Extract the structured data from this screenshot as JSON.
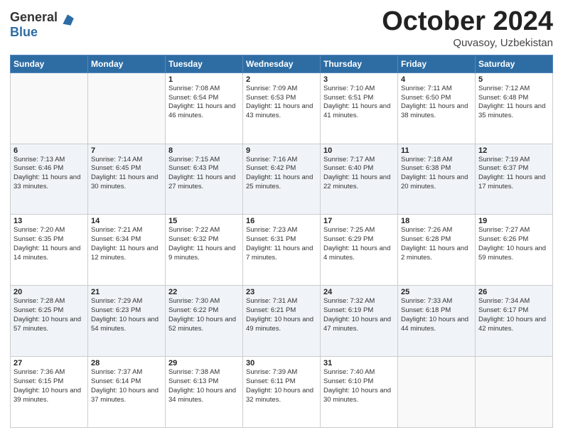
{
  "logo": {
    "general": "General",
    "blue": "Blue"
  },
  "header": {
    "month": "October 2024",
    "location": "Quvasoy, Uzbekistan"
  },
  "weekdays": [
    "Sunday",
    "Monday",
    "Tuesday",
    "Wednesday",
    "Thursday",
    "Friday",
    "Saturday"
  ],
  "weeks": [
    [
      {
        "day": null
      },
      {
        "day": null
      },
      {
        "day": "1",
        "sunrise": "Sunrise: 7:08 AM",
        "sunset": "Sunset: 6:54 PM",
        "daylight": "Daylight: 11 hours and 46 minutes."
      },
      {
        "day": "2",
        "sunrise": "Sunrise: 7:09 AM",
        "sunset": "Sunset: 6:53 PM",
        "daylight": "Daylight: 11 hours and 43 minutes."
      },
      {
        "day": "3",
        "sunrise": "Sunrise: 7:10 AM",
        "sunset": "Sunset: 6:51 PM",
        "daylight": "Daylight: 11 hours and 41 minutes."
      },
      {
        "day": "4",
        "sunrise": "Sunrise: 7:11 AM",
        "sunset": "Sunset: 6:50 PM",
        "daylight": "Daylight: 11 hours and 38 minutes."
      },
      {
        "day": "5",
        "sunrise": "Sunrise: 7:12 AM",
        "sunset": "Sunset: 6:48 PM",
        "daylight": "Daylight: 11 hours and 35 minutes."
      }
    ],
    [
      {
        "day": "6",
        "sunrise": "Sunrise: 7:13 AM",
        "sunset": "Sunset: 6:46 PM",
        "daylight": "Daylight: 11 hours and 33 minutes."
      },
      {
        "day": "7",
        "sunrise": "Sunrise: 7:14 AM",
        "sunset": "Sunset: 6:45 PM",
        "daylight": "Daylight: 11 hours and 30 minutes."
      },
      {
        "day": "8",
        "sunrise": "Sunrise: 7:15 AM",
        "sunset": "Sunset: 6:43 PM",
        "daylight": "Daylight: 11 hours and 27 minutes."
      },
      {
        "day": "9",
        "sunrise": "Sunrise: 7:16 AM",
        "sunset": "Sunset: 6:42 PM",
        "daylight": "Daylight: 11 hours and 25 minutes."
      },
      {
        "day": "10",
        "sunrise": "Sunrise: 7:17 AM",
        "sunset": "Sunset: 6:40 PM",
        "daylight": "Daylight: 11 hours and 22 minutes."
      },
      {
        "day": "11",
        "sunrise": "Sunrise: 7:18 AM",
        "sunset": "Sunset: 6:38 PM",
        "daylight": "Daylight: 11 hours and 20 minutes."
      },
      {
        "day": "12",
        "sunrise": "Sunrise: 7:19 AM",
        "sunset": "Sunset: 6:37 PM",
        "daylight": "Daylight: 11 hours and 17 minutes."
      }
    ],
    [
      {
        "day": "13",
        "sunrise": "Sunrise: 7:20 AM",
        "sunset": "Sunset: 6:35 PM",
        "daylight": "Daylight: 11 hours and 14 minutes."
      },
      {
        "day": "14",
        "sunrise": "Sunrise: 7:21 AM",
        "sunset": "Sunset: 6:34 PM",
        "daylight": "Daylight: 11 hours and 12 minutes."
      },
      {
        "day": "15",
        "sunrise": "Sunrise: 7:22 AM",
        "sunset": "Sunset: 6:32 PM",
        "daylight": "Daylight: 11 hours and 9 minutes."
      },
      {
        "day": "16",
        "sunrise": "Sunrise: 7:23 AM",
        "sunset": "Sunset: 6:31 PM",
        "daylight": "Daylight: 11 hours and 7 minutes."
      },
      {
        "day": "17",
        "sunrise": "Sunrise: 7:25 AM",
        "sunset": "Sunset: 6:29 PM",
        "daylight": "Daylight: 11 hours and 4 minutes."
      },
      {
        "day": "18",
        "sunrise": "Sunrise: 7:26 AM",
        "sunset": "Sunset: 6:28 PM",
        "daylight": "Daylight: 11 hours and 2 minutes."
      },
      {
        "day": "19",
        "sunrise": "Sunrise: 7:27 AM",
        "sunset": "Sunset: 6:26 PM",
        "daylight": "Daylight: 10 hours and 59 minutes."
      }
    ],
    [
      {
        "day": "20",
        "sunrise": "Sunrise: 7:28 AM",
        "sunset": "Sunset: 6:25 PM",
        "daylight": "Daylight: 10 hours and 57 minutes."
      },
      {
        "day": "21",
        "sunrise": "Sunrise: 7:29 AM",
        "sunset": "Sunset: 6:23 PM",
        "daylight": "Daylight: 10 hours and 54 minutes."
      },
      {
        "day": "22",
        "sunrise": "Sunrise: 7:30 AM",
        "sunset": "Sunset: 6:22 PM",
        "daylight": "Daylight: 10 hours and 52 minutes."
      },
      {
        "day": "23",
        "sunrise": "Sunrise: 7:31 AM",
        "sunset": "Sunset: 6:21 PM",
        "daylight": "Daylight: 10 hours and 49 minutes."
      },
      {
        "day": "24",
        "sunrise": "Sunrise: 7:32 AM",
        "sunset": "Sunset: 6:19 PM",
        "daylight": "Daylight: 10 hours and 47 minutes."
      },
      {
        "day": "25",
        "sunrise": "Sunrise: 7:33 AM",
        "sunset": "Sunset: 6:18 PM",
        "daylight": "Daylight: 10 hours and 44 minutes."
      },
      {
        "day": "26",
        "sunrise": "Sunrise: 7:34 AM",
        "sunset": "Sunset: 6:17 PM",
        "daylight": "Daylight: 10 hours and 42 minutes."
      }
    ],
    [
      {
        "day": "27",
        "sunrise": "Sunrise: 7:36 AM",
        "sunset": "Sunset: 6:15 PM",
        "daylight": "Daylight: 10 hours and 39 minutes."
      },
      {
        "day": "28",
        "sunrise": "Sunrise: 7:37 AM",
        "sunset": "Sunset: 6:14 PM",
        "daylight": "Daylight: 10 hours and 37 minutes."
      },
      {
        "day": "29",
        "sunrise": "Sunrise: 7:38 AM",
        "sunset": "Sunset: 6:13 PM",
        "daylight": "Daylight: 10 hours and 34 minutes."
      },
      {
        "day": "30",
        "sunrise": "Sunrise: 7:39 AM",
        "sunset": "Sunset: 6:11 PM",
        "daylight": "Daylight: 10 hours and 32 minutes."
      },
      {
        "day": "31",
        "sunrise": "Sunrise: 7:40 AM",
        "sunset": "Sunset: 6:10 PM",
        "daylight": "Daylight: 10 hours and 30 minutes."
      },
      {
        "day": null
      },
      {
        "day": null
      }
    ]
  ]
}
